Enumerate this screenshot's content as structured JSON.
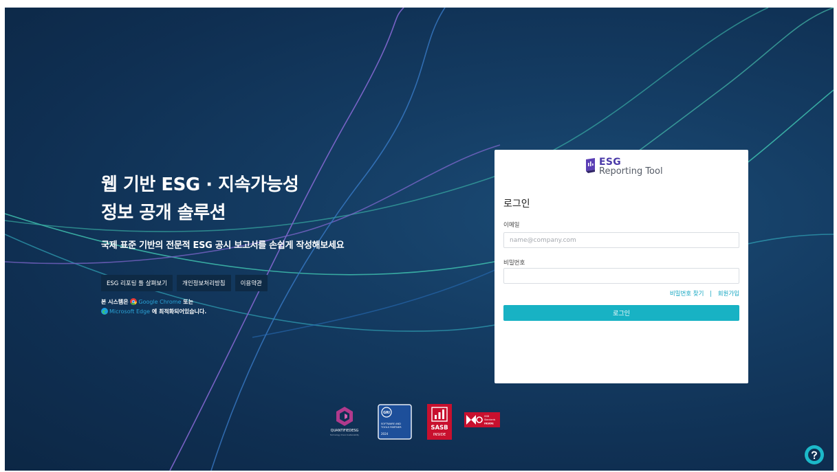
{
  "hero": {
    "title_line1": "웹 기반 ESG · 지속가능성",
    "title_line2": "정보 공개 솔루션",
    "subtitle": "국제 표준 기반의 전문적 ESG 공시 보고서를 손쉽게 작성해보세요"
  },
  "links": [
    {
      "label": "ESG 리포팅 툴 살펴보기"
    },
    {
      "label": "개인정보처리방침"
    },
    {
      "label": "이용약관"
    }
  ],
  "browser_note": {
    "prefix": "본 시스템은",
    "chrome": "Google Chrome",
    "or": "또는",
    "edge": "Microsoft Edge",
    "suffix": "에 최적화되어있습니다."
  },
  "logo": {
    "line1": "ESG",
    "line2": "Reporting Tool"
  },
  "login": {
    "heading": "로그인",
    "email_label": "이메일",
    "email_placeholder": "name@company.com",
    "email_value": "",
    "password_label": "비밀번호",
    "password_value": "",
    "find_password": "비밀번호 찾기",
    "separator": "|",
    "signup": "회원가입",
    "submit": "로그인"
  },
  "badges": {
    "quantified": {
      "name": "QUANTIFIEDESG",
      "tagline": "Technology driven Sustainability"
    },
    "gri": {
      "mark": "GRI",
      "line1": "SOFTWARE AND",
      "line2": "TOOLS PARTNER",
      "year": "2024"
    },
    "sasb": {
      "line1": "SASB",
      "line2": "INSIDE"
    },
    "issb": {
      "line1": "ISSB",
      "line2": "Standards",
      "line3": "INSIDE"
    }
  },
  "colors": {
    "background": "#143c63",
    "accent": "#18b2c4",
    "link": "#11a5c1",
    "brand_purple": "#4a3aa8",
    "sasb_red": "#c8102e"
  },
  "icons": {
    "help": "question-circle-icon",
    "chrome": "chrome-icon",
    "edge": "edge-icon"
  }
}
